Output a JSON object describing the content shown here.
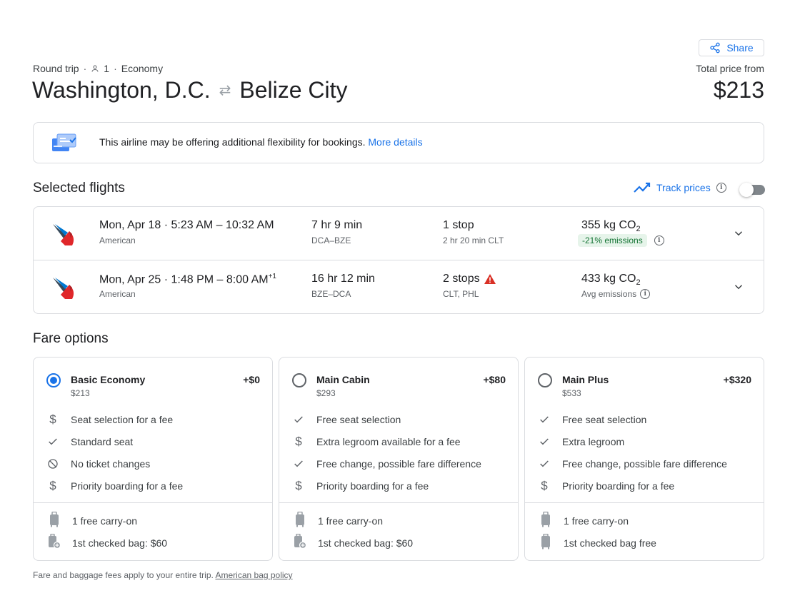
{
  "header": {
    "share_label": "Share",
    "trip_type": "Round trip",
    "passengers": "1",
    "cabin": "Economy",
    "origin": "Washington, D.C.",
    "destination": "Belize City",
    "price_label": "Total price from",
    "price_total": "$213"
  },
  "notice": {
    "text": "This airline may be offering additional flexibility for bookings.",
    "link": "More details"
  },
  "selected_flights": {
    "title": "Selected flights",
    "track_prices_label": "Track prices",
    "track_prices_on": false,
    "flights": [
      {
        "date": "Mon, Apr 18",
        "times": "5:23 AM – 10:32 AM",
        "arrival_offset": "",
        "airline": "American",
        "duration": "7 hr 9 min",
        "route": "DCA–BZE",
        "stops": "1 stop",
        "stop_info": "2 hr 20 min CLT",
        "co2_value": "355 kg CO",
        "co2_sub": "2",
        "emissions": "-21% emissions"
      },
      {
        "date": "Mon, Apr 25",
        "times": "1:48 PM – 8:00 AM",
        "arrival_offset": "+1",
        "airline": "American",
        "duration": "16 hr 12 min",
        "route": "BZE–DCA",
        "stops": "2 stops",
        "stop_info": "CLT, PHL",
        "co2_value": "433 kg CO",
        "co2_sub": "2",
        "emissions": "Avg emissions"
      }
    ]
  },
  "fare_options": {
    "title": "Fare options",
    "cards": [
      {
        "name": "Basic Economy",
        "price": "$213",
        "add": "+$0",
        "selected": true,
        "features": [
          {
            "icon": "dollar-icon",
            "text": "Seat selection for a fee"
          },
          {
            "icon": "check-icon",
            "text": "Standard seat"
          },
          {
            "icon": "no-entry-icon",
            "text": "No ticket changes"
          },
          {
            "icon": "dollar-icon",
            "text": "Priority boarding for a fee"
          }
        ],
        "bags": [
          {
            "icon": "carry-on-icon",
            "text": "1 free carry-on"
          },
          {
            "icon": "checked-bag-fee-icon",
            "text": "1st checked bag: $60"
          }
        ]
      },
      {
        "name": "Main Cabin",
        "price": "$293",
        "add": "+$80",
        "selected": false,
        "features": [
          {
            "icon": "check-icon",
            "text": "Free seat selection"
          },
          {
            "icon": "dollar-icon",
            "text": "Extra legroom available for a fee"
          },
          {
            "icon": "check-icon",
            "text": "Free change, possible fare difference"
          },
          {
            "icon": "dollar-icon",
            "text": "Priority boarding for a fee"
          }
        ],
        "bags": [
          {
            "icon": "carry-on-icon",
            "text": "1 free carry-on"
          },
          {
            "icon": "checked-bag-fee-icon",
            "text": "1st checked bag: $60"
          }
        ]
      },
      {
        "name": "Main Plus",
        "price": "$533",
        "add": "+$320",
        "selected": false,
        "features": [
          {
            "icon": "check-icon",
            "text": "Free seat selection"
          },
          {
            "icon": "check-icon",
            "text": "Extra legroom"
          },
          {
            "icon": "check-icon",
            "text": "Free change, possible fare difference"
          },
          {
            "icon": "dollar-icon",
            "text": "Priority boarding for a fee"
          }
        ],
        "bags": [
          {
            "icon": "carry-on-icon",
            "text": "1 free carry-on"
          },
          {
            "icon": "checked-bag-icon",
            "text": "1st checked bag free"
          }
        ]
      }
    ]
  },
  "footer": {
    "text": "Fare and baggage fees apply to your entire trip.",
    "link": "American bag policy"
  },
  "colors": {
    "accent": "#1a73e8",
    "text": "#202124",
    "muted": "#5f6368",
    "border": "#dadce0",
    "eco_badge_bg": "#e6f4ea",
    "eco_badge_text": "#137333",
    "warning": "#d93025"
  }
}
